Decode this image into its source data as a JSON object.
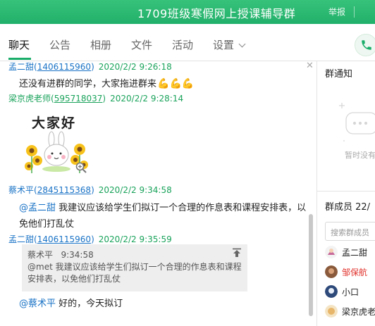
{
  "window": {
    "title": "1709班级寒假网上授课辅导群",
    "report_label": "举报"
  },
  "tabs": [
    {
      "label": "聊天",
      "active": true
    },
    {
      "label": "公告",
      "active": false
    },
    {
      "label": "相册",
      "active": false
    },
    {
      "label": "文件",
      "active": false
    },
    {
      "label": "活动",
      "active": false
    },
    {
      "label": "设置",
      "active": false
    }
  ],
  "messages": [
    {
      "sender": "孟二甜",
      "uid": "1406115960",
      "time": "2020/2/2 9:26:18",
      "text": "还没有进群的同学，大家拖进群来"
    },
    {
      "sender": "梁京虎老师",
      "uid": "595718037",
      "time": "2020/2/2 9:28:14",
      "sticker_text": "大家好"
    },
    {
      "sender": "蔡术平",
      "uid": "2845115368",
      "time": "2020/2/2 9:34:58",
      "mention": "@孟二甜",
      "text_line1": " 我建议应该给学生们拟订一个合理的作息表和课程安排表，以",
      "text_line2": "免他们打乱仗"
    },
    {
      "sender": "孟二甜",
      "uid": "1406115960",
      "time": "2020/2/2 9:35:59",
      "quote": {
        "author": "蔡术平",
        "time": "9:34:58",
        "text": "@met 我建议应该给学生们拟订一个合理的作息表和课程安排表，以免他们打乱仗"
      },
      "mention": "@蔡术平",
      "text": " 好的，今天拟订"
    }
  ],
  "right_panel": {
    "notice_title": "群通知",
    "notice_empty": "暂时没有",
    "members_title": "群成员 22/",
    "search_placeholder": "搜索群成员",
    "members": [
      {
        "name": "孟二甜",
        "highlight": false
      },
      {
        "name": "邹保航",
        "highlight": true
      },
      {
        "name": "小口",
        "highlight": false
      },
      {
        "name": "梁京虎老",
        "highlight": false
      }
    ]
  },
  "colors": {
    "title_bar": "#21b06a",
    "accent": "#1aad6a",
    "link": "#1a73c6",
    "timestamp": "#1aa35b"
  }
}
